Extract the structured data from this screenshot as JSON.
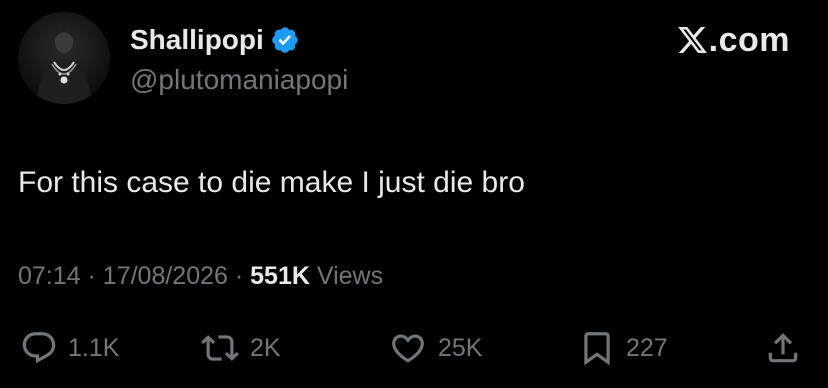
{
  "header": {
    "display_name": "Shallipopi",
    "handle": "@plutomaniapopi",
    "verified": true,
    "verified_badge_color": "#1d9bf0",
    "brand_text": ".com"
  },
  "tweet": {
    "text": "For this case to die make I just die bro"
  },
  "meta": {
    "time": "07:14",
    "separator": "·",
    "date": "17/08/2026",
    "views_count": "551K",
    "views_label": "Views"
  },
  "actions": {
    "replies": "1.1K",
    "reposts": "2K",
    "likes": "25K",
    "bookmarks": "227"
  },
  "colors": {
    "background": "#000000",
    "primary_text": "#e7e9ea",
    "secondary_text": "#71767b",
    "accent": "#1d9bf0"
  }
}
